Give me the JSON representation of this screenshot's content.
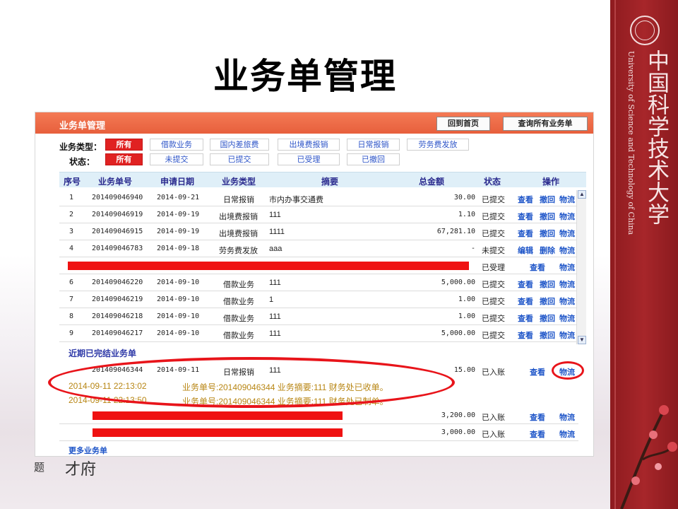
{
  "slide": {
    "title": "业务单管理",
    "school_cn": "中国科学技术大学",
    "school_en": "University of Science and Technology of China",
    "corner_mark": "才府",
    "corner_small": "题"
  },
  "app": {
    "title": "业务单管理",
    "home_button": "回到首页",
    "query_all_button": "查询所有业务单",
    "filters": {
      "type_label": "业务类型：",
      "type_options": [
        "所有",
        "借款业务",
        "国内差旅费",
        "出境费报销",
        "日常报销",
        "劳务费发放"
      ],
      "type_selected": "所有",
      "status_label": "状态：",
      "status_options": [
        "所有",
        "未提交",
        "已提交",
        "已受理",
        "已撤回"
      ],
      "status_selected": "所有"
    },
    "table": {
      "headers": [
        "序号",
        "业务单号",
        "申请日期",
        "业务类型",
        "摘要",
        "总金额",
        "状态",
        "操作"
      ],
      "rows": [
        {
          "no": "1",
          "id": "201409046940",
          "date": "2014-09-21",
          "type": "日常报销",
          "summary": "市内办事交通费",
          "amount": "30.00",
          "status": "已提交",
          "actions": [
            "查看",
            "撤回",
            "物流"
          ]
        },
        {
          "no": "2",
          "id": "201409046919",
          "date": "2014-09-19",
          "type": "出境费报销",
          "summary": "111",
          "amount": "1.10",
          "status": "已提交",
          "actions": [
            "查看",
            "撤回",
            "物流"
          ]
        },
        {
          "no": "3",
          "id": "201409046915",
          "date": "2014-09-19",
          "type": "出境费报销",
          "summary": "1111",
          "amount": "67,281.10",
          "status": "已提交",
          "actions": [
            "查看",
            "撤回",
            "物流"
          ]
        },
        {
          "no": "4",
          "id": "201409046783",
          "date": "2014-09-18",
          "type": "劳务费发放",
          "summary": "aaa",
          "amount": "-",
          "status": "未提交",
          "actions": [
            "编辑",
            "删除",
            "物流"
          ]
        },
        {
          "no": "",
          "id": "",
          "date": "",
          "type": "",
          "summary": "",
          "amount": "",
          "status": "已受理",
          "actions": [
            "查看",
            "物流"
          ],
          "redacted": true
        },
        {
          "no": "6",
          "id": "201409046220",
          "date": "2014-09-10",
          "type": "借款业务",
          "summary": "111",
          "amount": "5,000.00",
          "status": "已提交",
          "actions": [
            "查看",
            "撤回",
            "物流"
          ]
        },
        {
          "no": "7",
          "id": "201409046219",
          "date": "2014-09-10",
          "type": "借款业务",
          "summary": "1",
          "amount": "1.00",
          "status": "已提交",
          "actions": [
            "查看",
            "撤回",
            "物流"
          ]
        },
        {
          "no": "8",
          "id": "201409046218",
          "date": "2014-09-10",
          "type": "借款业务",
          "summary": "111",
          "amount": "1.00",
          "status": "已提交",
          "actions": [
            "查看",
            "撤回",
            "物流"
          ]
        },
        {
          "no": "9",
          "id": "201409046217",
          "date": "2014-09-10",
          "type": "借款业务",
          "summary": "111",
          "amount": "5,000.00",
          "status": "已提交",
          "actions": [
            "查看",
            "撤回",
            "物流"
          ]
        }
      ]
    },
    "recent": {
      "title": "近期已完结业务单",
      "rows": [
        {
          "id": "201409046344",
          "date": "2014-09-11",
          "type": "日常报销",
          "summary": "111",
          "amount": "15.00",
          "status": "已入账",
          "actions": [
            "查看",
            "物流"
          ]
        },
        {
          "id": "",
          "date": "",
          "type": "",
          "summary": "",
          "amount": "3,200.00",
          "status": "已入账",
          "actions": [
            "查看",
            "物流"
          ],
          "redacted": true
        },
        {
          "id": "",
          "date": "",
          "type": "",
          "summary": "",
          "amount": "3,000.00",
          "status": "已入账",
          "actions": [
            "查看",
            "物流"
          ],
          "redacted": true
        }
      ],
      "logistics_log": [
        {
          "time": "2014-09-11 22:13:02",
          "text": "业务单号:201409046344 业务摘要:111 财务处已收单。"
        },
        {
          "time": "2014-09-11 22:13:50",
          "text": "业务单号:201409046344 业务摘要:111 财务处已制单。"
        }
      ]
    },
    "more_link": "更多业务单"
  },
  "colors": {
    "header_orange": "#e9643f",
    "active_red": "#e02222",
    "link_blue": "#1e55c8",
    "annotation_red": "#e8141a",
    "log_gold": "#b88614",
    "band_red": "#9e2226"
  }
}
